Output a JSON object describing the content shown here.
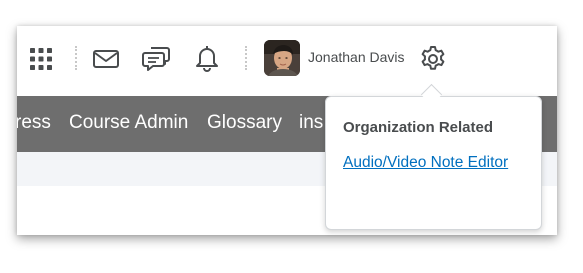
{
  "user": {
    "name": "Jonathan Davis"
  },
  "topbar": {
    "icons": [
      "apps-grid-icon",
      "mail-icon",
      "chat-icon",
      "bell-icon",
      "gear-icon"
    ]
  },
  "navbar": {
    "items": [
      {
        "label": "ress"
      },
      {
        "label": "Course Admin"
      },
      {
        "label": "Glossary"
      },
      {
        "label": "ins"
      }
    ],
    "background": "#6e6e6e"
  },
  "dropdown": {
    "heading": "Organization Related",
    "link_label": "Audio/Video Note Editor",
    "link_color": "#006fbf"
  }
}
